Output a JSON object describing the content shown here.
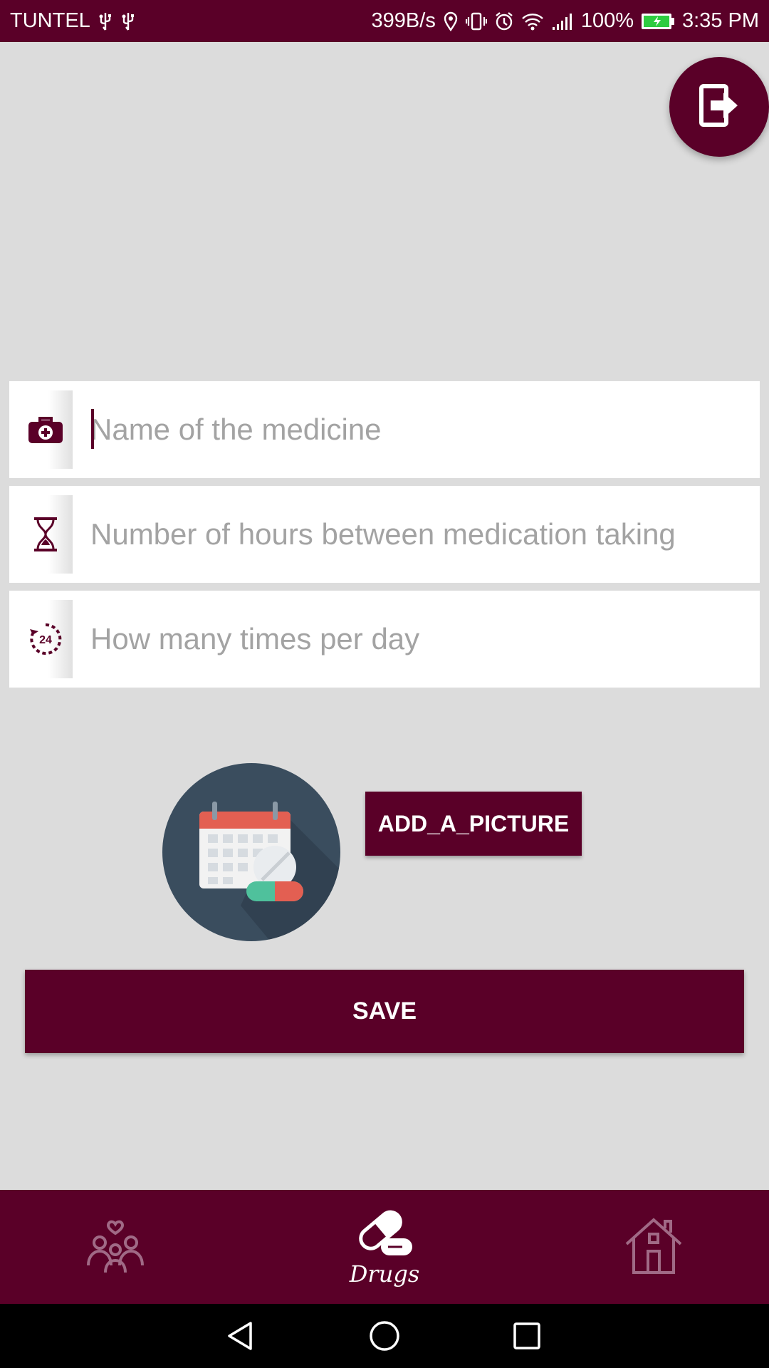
{
  "status_bar": {
    "carrier": "TUNTEL",
    "network_speed": "399B/s",
    "battery_percent": "100%",
    "time": "3:35 PM"
  },
  "form": {
    "medicine_name": {
      "placeholder": "Name of the medicine",
      "value": "",
      "icon": "medical-kit-icon"
    },
    "hours_between": {
      "placeholder": "Number of hours between medication taking",
      "value": "",
      "icon": "hourglass-icon"
    },
    "times_per_day": {
      "placeholder": "How many times per day",
      "value": "",
      "icon": "24-hours-icon"
    }
  },
  "picture": {
    "add_label": "ADD_A_PICTURE",
    "icon": "calendar-pill-icon"
  },
  "save_label": "SAVE",
  "bottom_nav": {
    "items": [
      {
        "icon": "family-icon",
        "label": ""
      },
      {
        "icon": "pills-icon",
        "label": "Drugs",
        "active": true
      },
      {
        "icon": "home-icon",
        "label": ""
      }
    ]
  },
  "colors": {
    "primary": "#5a0028",
    "background": "#dcdcdc",
    "accent_red": "#e35f52",
    "accent_green": "#4fc19c"
  }
}
